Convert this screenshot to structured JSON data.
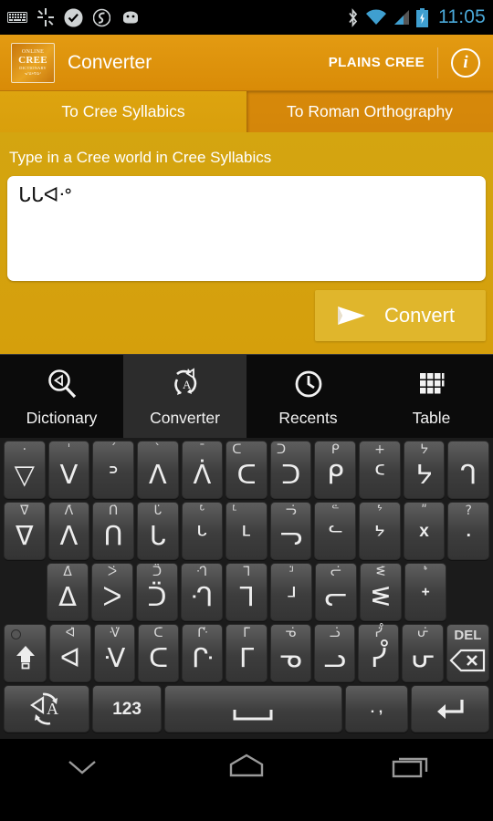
{
  "statusbar": {
    "icons_left": [
      "keyboard-icon",
      "sync-icon",
      "check-circle-icon",
      "s-logo-icon",
      "android-face-icon"
    ],
    "icons_right": [
      "bluetooth-icon",
      "wifi-icon",
      "cellular-signal-icon",
      "battery-charging-icon"
    ],
    "time": "11:05"
  },
  "appbar": {
    "logo": {
      "line1": "ONLINE",
      "line2": "CREE",
      "line3": "DICTIONARY",
      "line4": "ᓀᐦᐃᔭᐍᐏᐣ"
    },
    "title": "Converter",
    "dialect": "PLAINS CREE",
    "info_label": "i"
  },
  "tabs": [
    {
      "label": "To Cree Syllabics",
      "active": true
    },
    {
      "label": "To Roman Orthography",
      "active": false
    }
  ],
  "main": {
    "prompt": "Type in a Cree world in Cree Syllabics",
    "input_value": "ᒐᒐᐊᐧᐤ",
    "input_placeholder": "",
    "convert_label": "Convert",
    "convert_icon": "send-icon"
  },
  "bottom_nav": [
    {
      "label": "Dictionary",
      "icon": "search-syllabic-icon",
      "active": false
    },
    {
      "label": "Converter",
      "icon": "convert-arrows-icon",
      "active": true
    },
    {
      "label": "Recents",
      "icon": "clock-icon",
      "active": false
    },
    {
      "label": "Table",
      "icon": "grid-table-icon",
      "active": false
    }
  ],
  "keyboard": {
    "rows": [
      {
        "name": "row-1",
        "keys": [
          {
            "main": "▽",
            "hint": "·",
            "hint_pos": "center"
          },
          {
            "main": "ᐯ",
            "hint": "ˈ",
            "hint_pos": "center"
          },
          {
            "main": "ᐣ",
            "hint": "´",
            "hint_pos": "center"
          },
          {
            "main": "ᐱ",
            "hint": "ˋ",
            "hint_pos": "center"
          },
          {
            "main": "ᐲ",
            "hint": "¯",
            "hint_pos": "center"
          },
          {
            "main": "ᑕ",
            "hint": "ᑕ",
            "hint_pos": "left"
          },
          {
            "main": "ᑐ",
            "hint": "ᑐ",
            "hint_pos": "left"
          },
          {
            "main": "ᑭ",
            "hint": "ᑭ",
            "hint_pos": "center"
          },
          {
            "main": "ᑦ",
            "hint": "+",
            "hint_pos": "center"
          },
          {
            "main": "ᔭ",
            "hint": "ᔭ",
            "hint_pos": "center"
          },
          {
            "main": "ᒉ",
            "hint": "",
            "hint_pos": "center"
          }
        ]
      },
      {
        "name": "row-2",
        "keys": [
          {
            "main": "ᐁ",
            "hint": "ᐁ̇",
            "hint_pos": "center"
          },
          {
            "main": "ᐱ",
            "hint": "ᐱ̇",
            "hint_pos": "center"
          },
          {
            "main": "ᑎ",
            "hint": "ᑎ̇",
            "hint_pos": "center"
          },
          {
            "main": "ᒐ",
            "hint": "ᒐ̇",
            "hint_pos": "center"
          },
          {
            "main": "ᒡ",
            "hint": "ᒡ̇",
            "hint_pos": "center"
          },
          {
            "main": "ᒻ",
            "hint": "ᒻ̇",
            "hint_pos": "left"
          },
          {
            "main": "ᓓ",
            "hint": "ᓓ̇",
            "hint_pos": "center"
          },
          {
            "main": "ᓪ",
            "hint": "ᓪ̇",
            "hint_pos": "center"
          },
          {
            "main": "ᔾ",
            "hint": "ᔾ̇",
            "hint_pos": "center"
          },
          {
            "main": "x",
            "hint": "ʺ",
            "hint_pos": "center"
          },
          {
            "main": ".",
            "hint": "?",
            "hint_pos": "center"
          }
        ]
      },
      {
        "name": "row-3",
        "keys": [
          {
            "main": "ᐃ",
            "hint": "ᐃ̇",
            "hint_pos": "center"
          },
          {
            "main": "ᐳ",
            "hint": "ᐳ̇",
            "hint_pos": "center"
          },
          {
            "main": "ᑒ",
            "hint": "ᑒ̇",
            "hint_pos": "center"
          },
          {
            "main": "ᒒ",
            "hint": "ᒒ̇",
            "hint_pos": "center"
          },
          {
            "main": "ᒣ",
            "hint": "ᒣ̇",
            "hint_pos": "center"
          },
          {
            "main": "ᒽ",
            "hint": "ᒽ̇",
            "hint_pos": "center"
          },
          {
            "main": "ᓕ",
            "hint": "ᓕ̇",
            "hint_pos": "center"
          },
          {
            "main": "ᓬ",
            "hint": "ᓬ̇",
            "hint_pos": "center"
          },
          {
            "main": "ᕀ",
            "hint": "ᕀ̇",
            "hint_pos": "center"
          }
        ]
      },
      {
        "name": "row-4",
        "keys": [
          {
            "main": "⇧",
            "hint": "",
            "hint_pos": "center",
            "role": "shift",
            "icon": "shift-icon"
          },
          {
            "main": "ᐊ",
            "hint": "ᐊ̇",
            "hint_pos": "center"
          },
          {
            "main": "ᐺ",
            "hint": "ᐺ̇",
            "hint_pos": "center"
          },
          {
            "main": "ᑕ",
            "hint": "ᑕ̇",
            "hint_pos": "center"
          },
          {
            "main": "ᒕ",
            "hint": "ᒕ̇",
            "hint_pos": "center"
          },
          {
            "main": "ᒥ",
            "hint": "ᒥ̇",
            "hint_pos": "center"
          },
          {
            "main": "ᓀ",
            "hint": "ᓀ̇",
            "hint_pos": "center"
          },
          {
            "main": "ᓗ",
            "hint": "ᓗ̇",
            "hint_pos": "center"
          },
          {
            "main": "ᓮ",
            "hint": "ᓮ̇",
            "hint_pos": "center"
          },
          {
            "main": "ᕂ",
            "hint": "ᕂ̇",
            "hint_pos": "center"
          },
          {
            "main": "DEL",
            "hint": "",
            "hint_pos": "center",
            "role": "delete",
            "icon": "backspace-icon"
          }
        ]
      }
    ],
    "function_row": [
      {
        "label": "",
        "name": "language-switch-key",
        "icon": "language-switch-icon"
      },
      {
        "label": "123",
        "name": "numbers-key",
        "icon": ""
      },
      {
        "label": "",
        "name": "space-key",
        "icon": "space-icon"
      },
      {
        "label": ". ,",
        "name": "punctuation-key",
        "icon": ""
      },
      {
        "label": "",
        "name": "enter-key",
        "icon": "enter-icon"
      }
    ]
  },
  "android_nav": [
    {
      "name": "back-button",
      "icon": "chevron-down-icon"
    },
    {
      "name": "home-button",
      "icon": "home-icon"
    },
    {
      "name": "recents-button",
      "icon": "recents-icon"
    }
  ]
}
